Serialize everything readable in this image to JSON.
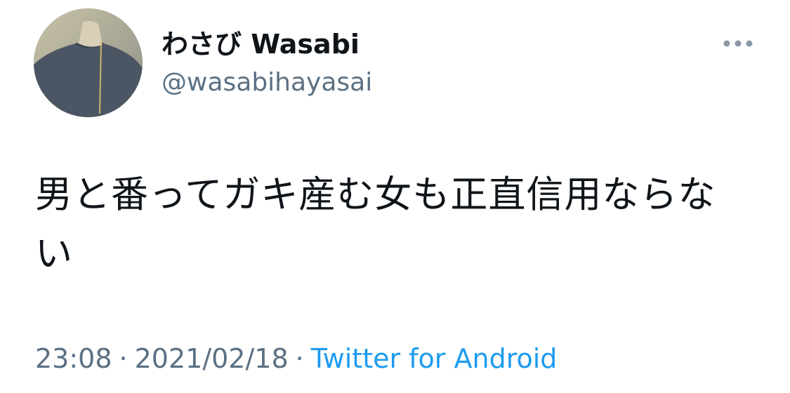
{
  "tweet": {
    "author": {
      "display_name": "わさび Wasabi",
      "handle": "@wasabihayasai",
      "avatar_icon": "profile-photo"
    },
    "more_icon": "more-horizontal-icon",
    "text": "男と番ってガキ産む女も正直信用ならない",
    "time": "23:08",
    "date": "2021/02/18",
    "separator": "·",
    "source": "Twitter for Android"
  },
  "colors": {
    "primary_text": "#0f1419",
    "secondary_text": "#5b7083",
    "link": "#1d9bf0",
    "background": "#ffffff"
  }
}
